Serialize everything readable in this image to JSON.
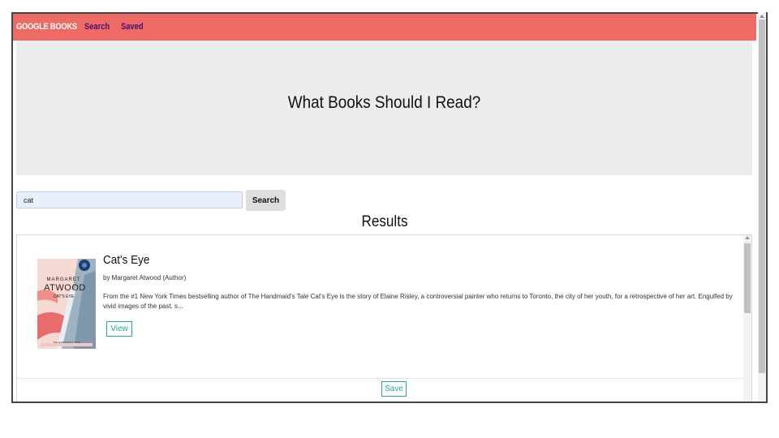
{
  "nav": {
    "brand": "GOOGLE BOOKS",
    "links": [
      "Search",
      "Saved"
    ]
  },
  "jumbotron": {
    "title": "What Books Should I Read?"
  },
  "search": {
    "value": "cat",
    "button_label": "Search"
  },
  "results": {
    "heading": "Results",
    "books": [
      {
        "title": "Cat's Eye",
        "author": "by Margaret Atwood (Author)",
        "description": "From the #1 New York Times bestselling author of The Handmaid's Tale Cat's Eye is the story of Elaine Risley, a controversial painter who returns to Toronto, the city of her youth, for a retrospective of her art. Engulfed by vivid images of the past, s...",
        "cover": {
          "author_first": "MARGARET",
          "author_last": "ATWOOD",
          "title": "CAT'S EYE",
          "footer": "THE HANDMAID'S TALE"
        },
        "view_label": "View",
        "save_label": "Save"
      }
    ]
  },
  "colors": {
    "navbar": "#ee6a65",
    "nav_link": "#4a1070",
    "jumbotron": "#ececec",
    "button_accent": "#26a69a",
    "search_input_bg": "#e8f0fe"
  }
}
